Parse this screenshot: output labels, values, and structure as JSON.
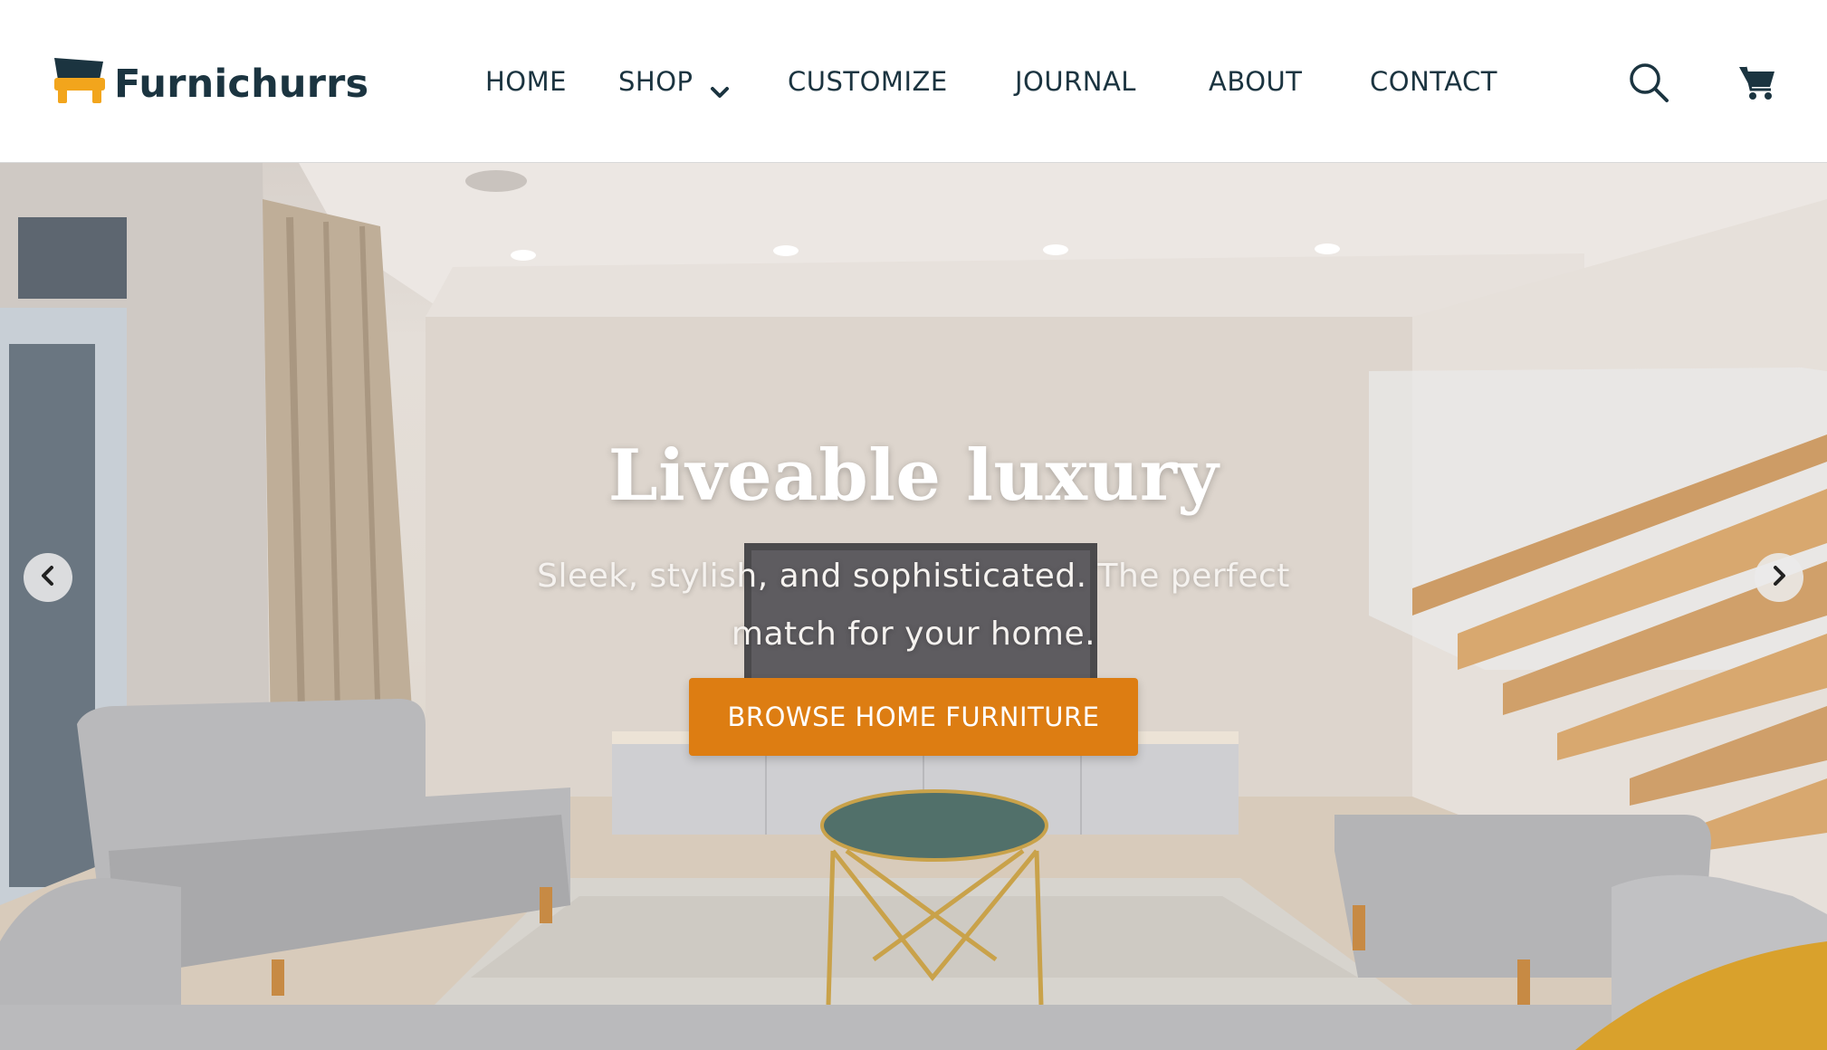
{
  "brand": {
    "name": "Furnichurrs",
    "logo_icon": "sofa-icon",
    "primary_color": "#1b3440",
    "accent_color": "#f2a51c"
  },
  "nav": {
    "home": "HOME",
    "shop": "SHOP",
    "customize": "CUSTOMIZE",
    "journal": "JOURNAL",
    "about": "ABOUT",
    "contact": "CONTACT"
  },
  "header_icons": {
    "search": "search-icon",
    "cart": "cart-icon"
  },
  "hero": {
    "title": "Liveable luxury",
    "subtitle": "Sleek, stylish, and sophisticated. The perfect match for your home.",
    "cta_label": "BROWSE HOME FURNITURE",
    "cta_color": "#dd7d12",
    "prev_icon": "chevron-left-icon",
    "next_icon": "chevron-right-icon"
  }
}
